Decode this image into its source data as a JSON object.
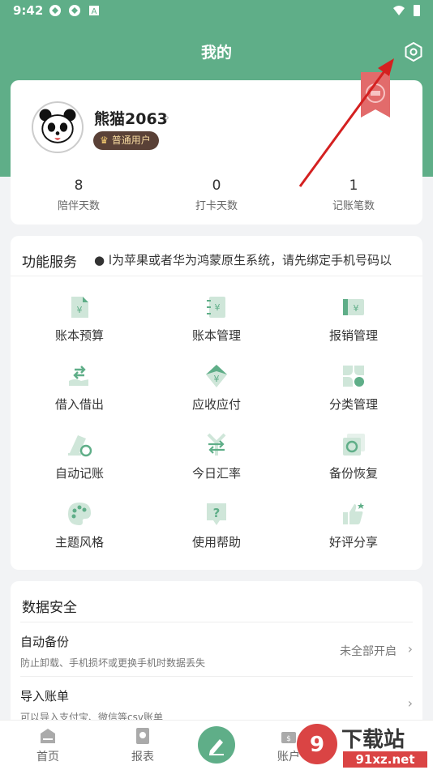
{
  "status_bar": {
    "time": "9:42"
  },
  "header": {
    "title": "我的"
  },
  "profile": {
    "username": "熊猫2063",
    "badge": "普通用户",
    "stats": [
      {
        "value": "8",
        "label": "陪伴天数"
      },
      {
        "value": "0",
        "label": "打卡天数"
      },
      {
        "value": "1",
        "label": "记账笔数"
      }
    ]
  },
  "services": {
    "title": "功能服务",
    "marquee": "●  l为苹果或者华为鸿蒙原生系统，请先绑定手机号码以",
    "items": [
      {
        "label": "账本预算",
        "icon": "budget-icon"
      },
      {
        "label": "账本管理",
        "icon": "book-manage-icon"
      },
      {
        "label": "报销管理",
        "icon": "reimburse-icon"
      },
      {
        "label": "借入借出",
        "icon": "borrow-lend-icon"
      },
      {
        "label": "应收应付",
        "icon": "receivable-icon"
      },
      {
        "label": "分类管理",
        "icon": "category-icon"
      },
      {
        "label": "自动记账",
        "icon": "auto-record-icon"
      },
      {
        "label": "今日汇率",
        "icon": "exchange-rate-icon"
      },
      {
        "label": "备份恢复",
        "icon": "backup-icon"
      },
      {
        "label": "主题风格",
        "icon": "palette-icon"
      },
      {
        "label": "使用帮助",
        "icon": "help-icon"
      },
      {
        "label": "好评分享",
        "icon": "thumbs-up-icon"
      }
    ]
  },
  "data_security": {
    "title": "数据安全",
    "rows": [
      {
        "title": "自动备份",
        "subtitle": "防止卸载、手机损坏或更换手机时数据丢失",
        "value": "未全部开启"
      },
      {
        "title": "导入账单",
        "subtitle": "可以导入支付宝、微信等csv账单",
        "value": ""
      }
    ]
  },
  "tabbar": {
    "items": [
      {
        "label": "首页"
      },
      {
        "label": "报表"
      },
      {
        "label": "账户"
      }
    ]
  },
  "watermark": {
    "text": "下载站",
    "url_text": "91xz.net"
  },
  "colors": {
    "primary": "#5fae88",
    "icon_light": "#cfe6d9",
    "icon_dark": "#5fae88",
    "badge_bg": "#5a4137",
    "arrow": "#d42020"
  }
}
